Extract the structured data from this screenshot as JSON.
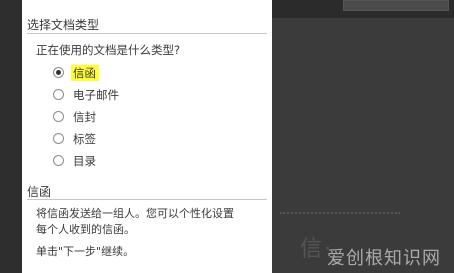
{
  "wizard": {
    "section_title": "选择文档类型",
    "question": "正在使用的文档是什么类型?",
    "options": [
      {
        "label": "信函",
        "selected": true
      },
      {
        "label": "电子邮件",
        "selected": false
      },
      {
        "label": "信封",
        "selected": false
      },
      {
        "label": "标签",
        "selected": false
      },
      {
        "label": "目录",
        "selected": false
      }
    ],
    "description_title": "信函",
    "description_line1": "将信函发送给一组人。您可以个性化设置",
    "description_line2": "每个人收到的信函。",
    "next_hint": "单击\"下一步\"继续。"
  },
  "background": {
    "document_heading_fragment": "信·",
    "watermark": "爱创根知识网"
  },
  "colors": {
    "highlight": "#ffff33",
    "pane": "#ffffff",
    "backdrop": "#3d3d3d"
  }
}
